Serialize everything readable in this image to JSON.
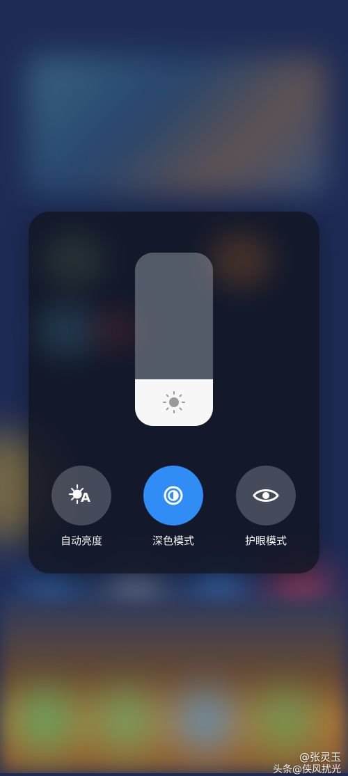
{
  "control_panel": {
    "brightness_level": 0.27,
    "tiles": [
      {
        "label": "自动亮度",
        "icon": "auto-brightness-icon",
        "active": false
      },
      {
        "label": "深色模式",
        "icon": "dark-mode-icon",
        "active": true
      },
      {
        "label": "护眼模式",
        "icon": "eye-icon",
        "active": false
      }
    ]
  },
  "colors": {
    "accent": "#2f8df5",
    "panel_bg": "#12162299"
  },
  "watermark": {
    "line1": "@张灵玉",
    "line2": "头条@侠风扰光"
  }
}
